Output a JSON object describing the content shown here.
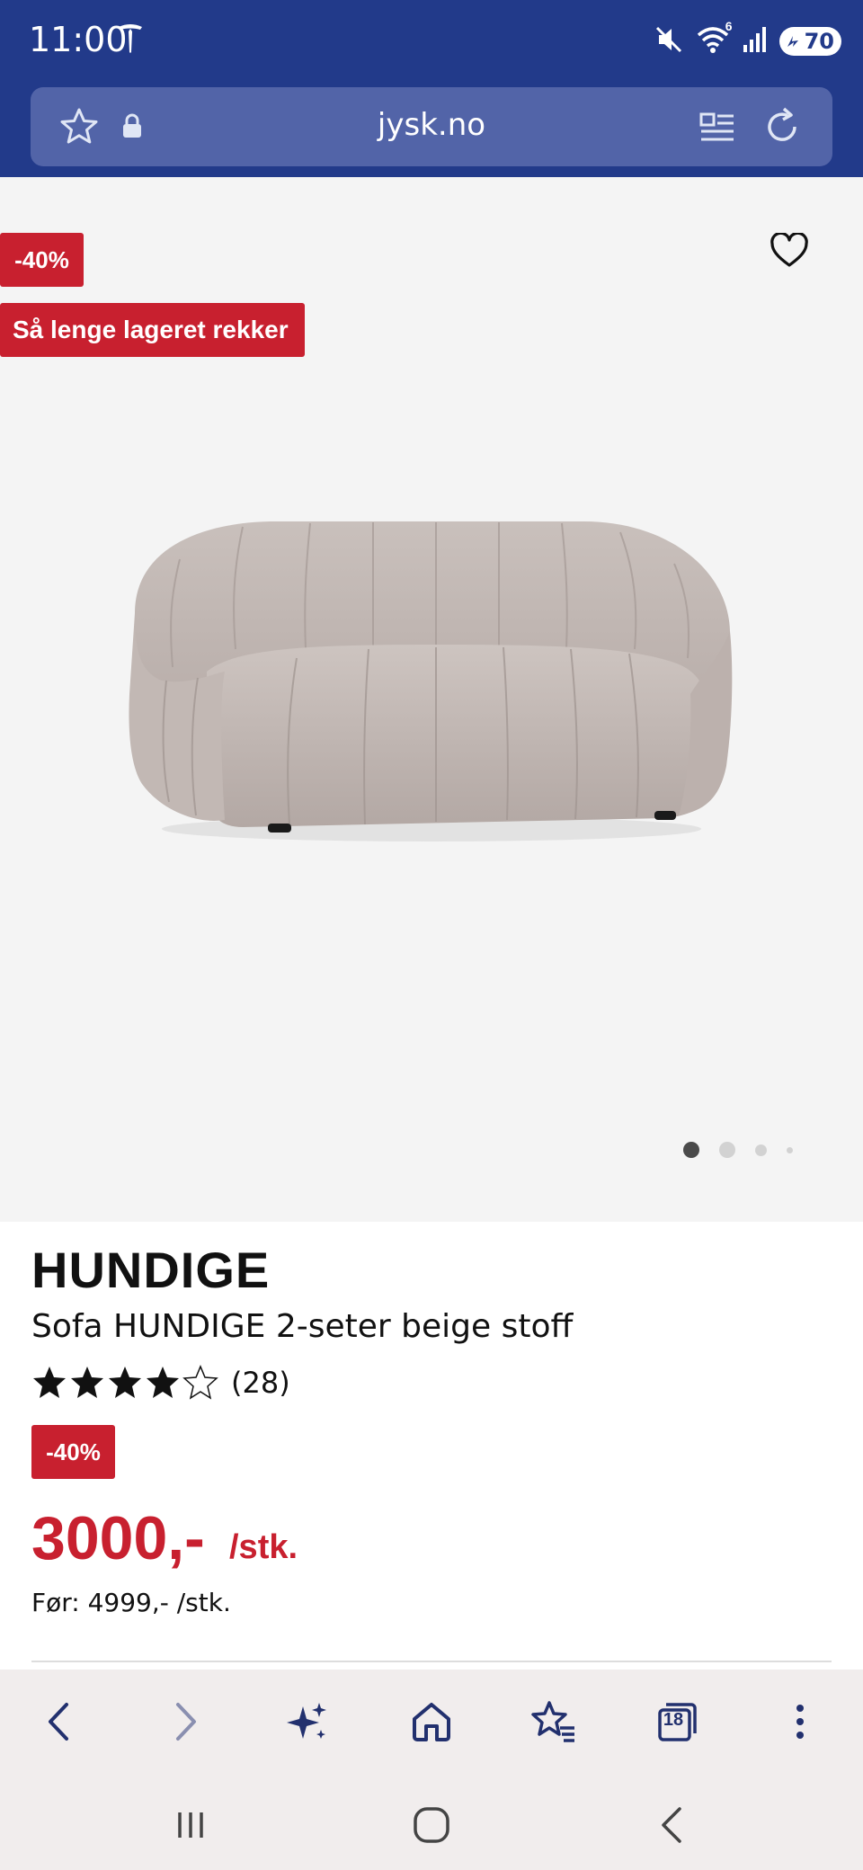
{
  "status_bar": {
    "time": "11:00",
    "wifi_badge": "6",
    "battery": "70"
  },
  "browser": {
    "url": "jysk.no",
    "tab_count": "18"
  },
  "product": {
    "badge_discount": "-40%",
    "badge_stock": "Så lenge lageret rekker",
    "brand": "HUNDIGE",
    "name": "Sofa HUNDIGE 2-seter beige stoff",
    "rating_stars": 4.6,
    "rating_count": "(28)",
    "price_discount_badge": "-40%",
    "price": "3000,-",
    "unit": "/stk.",
    "before_price": "Før: 4999,- /stk."
  },
  "gallery": {
    "image_count": 4,
    "active_index": 0
  },
  "colors": {
    "chrome": "#223a8a",
    "url_field": "#5264a8",
    "sale_red": "#c8202f",
    "gallery_bg": "#f4f4f4",
    "sofa": "#c6bcb8"
  },
  "icons": {
    "status": [
      "tesla-icon",
      "mute-icon",
      "wifi-icon",
      "signal-icon",
      "battery-icon"
    ],
    "url_bar": [
      "bookmark-star-icon",
      "lock-icon",
      "reader-mode-icon",
      "reload-icon"
    ],
    "toolbar": [
      "back-icon",
      "forward-icon",
      "sparkle-icon",
      "home-icon",
      "bookmarks-icon",
      "tabs-icon",
      "more-icon"
    ],
    "system_nav": [
      "recent-apps-icon",
      "home-circle-icon",
      "system-back-icon"
    ]
  }
}
